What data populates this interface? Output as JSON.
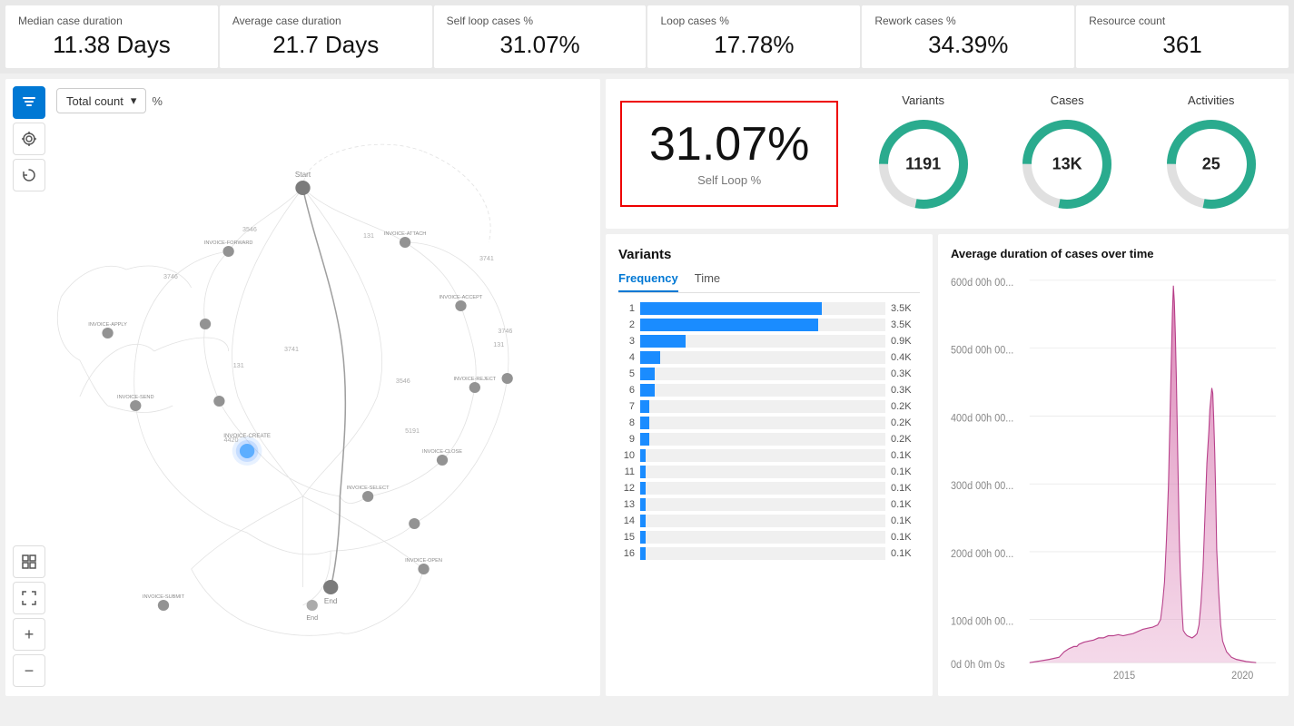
{
  "kpis": [
    {
      "label": "Median case duration",
      "value": "11.38 Days"
    },
    {
      "label": "Average case duration",
      "value": "21.7 Days"
    },
    {
      "label": "Self loop cases %",
      "value": "31.07%"
    },
    {
      "label": "Loop cases %",
      "value": "17.78%"
    },
    {
      "label": "Rework cases %",
      "value": "34.39%"
    },
    {
      "label": "Resource count",
      "value": "361"
    }
  ],
  "toolbar": {
    "icon_filter": "⊟",
    "icon_rotate": "↻",
    "icon_refresh": "↺",
    "icon_grid": "⊞",
    "icon_expand": "⤢",
    "icon_plus": "+",
    "icon_minus": "−"
  },
  "dropdown": {
    "label": "Total count",
    "pct": "%"
  },
  "stats": {
    "self_loop_pct": "31.07%",
    "self_loop_label": "Self Loop %",
    "circles": [
      {
        "title": "Variants",
        "value": "1191"
      },
      {
        "title": "Cases",
        "value": "13K"
      },
      {
        "title": "Activities",
        "value": "25"
      }
    ]
  },
  "variants": {
    "title": "Variants",
    "tabs": [
      "Frequency",
      "Time"
    ],
    "active_tab": "Frequency",
    "bars": [
      {
        "num": 1,
        "width_pct": 100,
        "label": "3.5K"
      },
      {
        "num": 2,
        "width_pct": 98,
        "label": "3.5K"
      },
      {
        "num": 3,
        "width_pct": 25,
        "label": "0.9K"
      },
      {
        "num": 4,
        "width_pct": 11,
        "label": "0.4K"
      },
      {
        "num": 5,
        "width_pct": 8,
        "label": "0.3K"
      },
      {
        "num": 6,
        "width_pct": 8,
        "label": "0.3K"
      },
      {
        "num": 7,
        "width_pct": 5,
        "label": "0.2K"
      },
      {
        "num": 8,
        "width_pct": 5,
        "label": "0.2K"
      },
      {
        "num": 9,
        "width_pct": 5,
        "label": "0.2K"
      },
      {
        "num": 10,
        "width_pct": 3,
        "label": "0.1K"
      },
      {
        "num": 11,
        "width_pct": 3,
        "label": "0.1K"
      },
      {
        "num": 12,
        "width_pct": 3,
        "label": "0.1K"
      },
      {
        "num": 13,
        "width_pct": 3,
        "label": "0.1K"
      },
      {
        "num": 14,
        "width_pct": 3,
        "label": "0.1K"
      },
      {
        "num": 15,
        "width_pct": 3,
        "label": "0.1K"
      },
      {
        "num": 16,
        "width_pct": 3,
        "label": "0.1K"
      }
    ]
  },
  "chart": {
    "title": "Average duration of cases over time",
    "y_labels": [
      "600d 00h 00...",
      "500d 00h 00...",
      "400d 00h 00...",
      "300d 00h 00...",
      "200d 00h 00...",
      "100d 00h 00...",
      "0d 0h 0m 0s"
    ],
    "x_labels": [
      "2015",
      "2020"
    ]
  }
}
